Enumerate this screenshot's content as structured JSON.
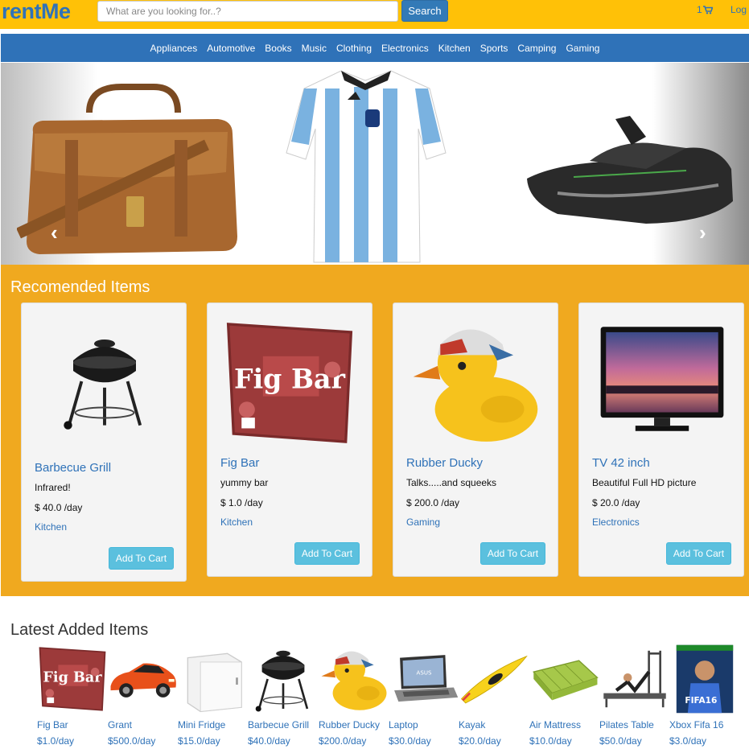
{
  "header": {
    "logo": "rentMe",
    "search_placeholder": "What are you looking for..?",
    "search_label": "Search",
    "cart_count": "1",
    "login_label": "Log"
  },
  "nav": [
    "Appliances",
    "Automotive",
    "Books",
    "Music",
    "Clothing",
    "Electronics",
    "Kitchen",
    "Sports",
    "Camping",
    "Gaming"
  ],
  "carousel": {
    "prev_glyph": "‹",
    "next_glyph": "›"
  },
  "recommended": {
    "title": "Recomended Items",
    "button_label": "Add To Cart",
    "items": [
      {
        "name": "Barbecue Grill",
        "desc": "Infrared!",
        "price": "$ 40.0 /day",
        "category": "Kitchen"
      },
      {
        "name": "Fig Bar",
        "desc": "yummy bar",
        "price": "$ 1.0 /day",
        "category": "Kitchen"
      },
      {
        "name": "Rubber Ducky",
        "desc": "Talks.....and squeeks",
        "price": "$ 200.0 /day",
        "category": "Gaming"
      },
      {
        "name": "TV 42 inch",
        "desc": "Beautiful Full HD picture",
        "price": "$ 20.0 /day",
        "category": "Electronics"
      }
    ]
  },
  "latest": {
    "title": "Latest Added Items",
    "items": [
      {
        "name": "Fig Bar",
        "price": "$1.0/day"
      },
      {
        "name": "Grant",
        "price": "$500.0/day"
      },
      {
        "name": "Mini Fridge",
        "price": "$15.0/day"
      },
      {
        "name": "Barbecue Grill",
        "price": "$40.0/day"
      },
      {
        "name": "Rubber Ducky",
        "price": "$200.0/day"
      },
      {
        "name": "Laptop",
        "price": "$30.0/day"
      },
      {
        "name": "Kayak",
        "price": "$20.0/day"
      },
      {
        "name": "Air Mattress",
        "price": "$10.0/day"
      },
      {
        "name": "Pilates Table",
        "price": "$50.0/day"
      },
      {
        "name": "Xbox Fifa 16",
        "price": "$3.0/day"
      }
    ]
  },
  "colors": {
    "header_bg": "#ffc107",
    "nav_bg": "#2f72b8",
    "section_bg": "#f0a91f",
    "accent": "#5bc0de"
  }
}
